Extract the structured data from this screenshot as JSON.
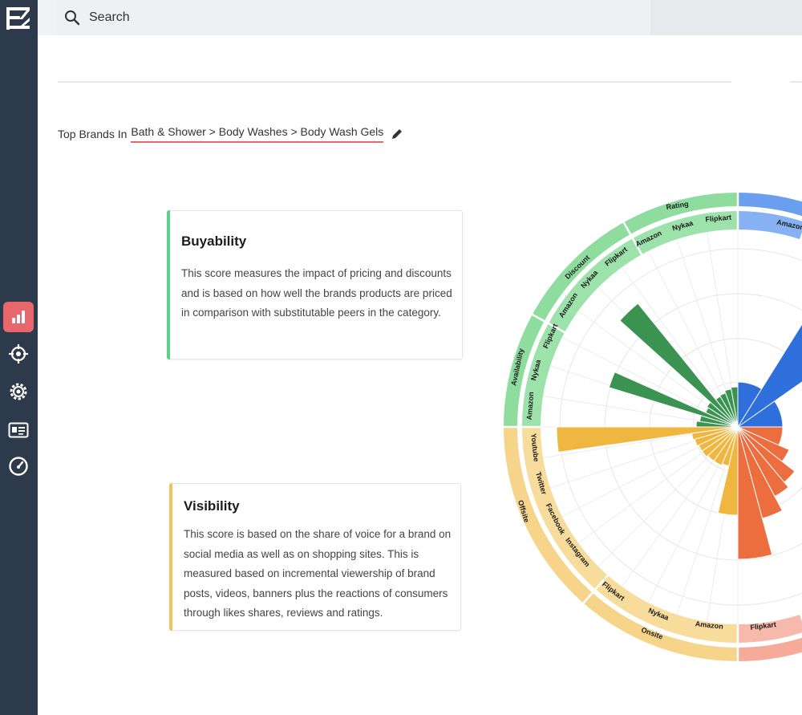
{
  "search": {
    "placeholder": "Search"
  },
  "breadcrumb": {
    "prefix": "Top Brands In",
    "path": "Bath & Shower > Body Washes > Body Wash Gels"
  },
  "sidebar": {
    "items": [
      {
        "icon": "bar-chart-icon",
        "active": true
      },
      {
        "icon": "crosshair-icon",
        "active": false
      },
      {
        "icon": "gear-icon",
        "active": false
      },
      {
        "icon": "id-card-icon",
        "active": false
      },
      {
        "icon": "speedometer-icon",
        "active": false
      }
    ]
  },
  "cards": {
    "buyability": {
      "title": "Buyability",
      "body": "This score measures the impact of pricing and discounts and is based on how well the brands products are priced in comparison with substitutable peers in the category.",
      "accent": "#5fd08a"
    },
    "visibility": {
      "title": "Visibility",
      "body": "This score is based on the share of voice for a brand on social media as well as on shopping sites. This is measured based on incremental viewership of brand posts, videos, banners plus the reactions of consumers through likes shares, reviews and ratings.",
      "accent": "#f2c25c"
    }
  },
  "colors": {
    "green_light": "#8fdc9f",
    "green_dark": "#3a9350",
    "blue": "#2e6fdc",
    "blue_light": "#6a9ff0",
    "yellow": "#efb73f",
    "yellow_light": "#f6d48a",
    "orange": "#ec6d3d",
    "pink_light": "#f5aa9a"
  },
  "chart_data": {
    "type": "radial-bar",
    "groups": [
      {
        "name": "Buyability",
        "color": "#8fdc9f",
        "subgroups": [
          {
            "name": "Rating",
            "items": [
              "Flipkart",
              "Nykaa",
              "Amazon"
            ]
          },
          {
            "name": "Discount",
            "items": [
              "Flipkart",
              "Nykaa",
              "Amazon"
            ]
          },
          {
            "name": "Availability",
            "items": [
              "Flipkart",
              "Nykaa",
              "Amazon"
            ]
          }
        ]
      },
      {
        "name": "Visibility",
        "color": "#f6d48a",
        "subgroups": [
          {
            "name": "Offsite",
            "items": [
              "Youtube",
              "Twitter",
              "Facebook",
              "Instagram"
            ]
          },
          {
            "name": "Onsite",
            "items": [
              "Flipkart",
              "Nykaa",
              "Amazon"
            ]
          }
        ]
      }
    ],
    "partial_labels": [
      "Amazon",
      "Flipkart"
    ]
  }
}
